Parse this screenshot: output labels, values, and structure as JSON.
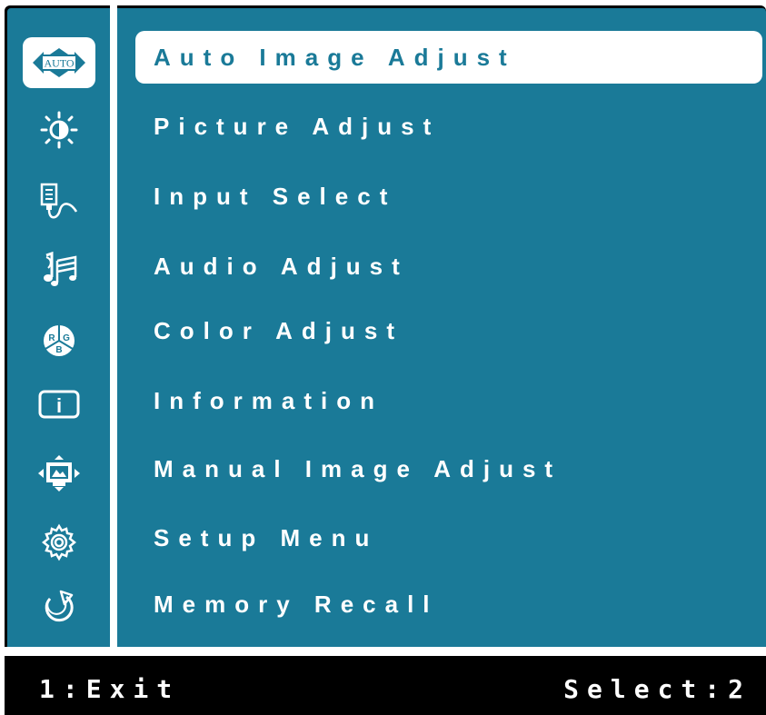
{
  "colors": {
    "panel": "#1a7a98",
    "highlight": "#ffffff",
    "footer": "#000000"
  },
  "menu": {
    "selected_index": 0,
    "items": [
      {
        "label": "Auto Image Adjust",
        "icon": "auto-icon"
      },
      {
        "label": "Picture Adjust",
        "icon": "brightness-icon"
      },
      {
        "label": "Input Select",
        "icon": "input-connector-icon"
      },
      {
        "label": "Audio Adjust",
        "icon": "music-note-icon"
      },
      {
        "label": "Color Adjust",
        "icon": "rgb-color-icon"
      },
      {
        "label": "Information",
        "icon": "info-icon"
      },
      {
        "label": "Manual Image Adjust",
        "icon": "image-adjust-icon"
      },
      {
        "label": "Setup Menu",
        "icon": "gear-icon"
      },
      {
        "label": "Memory Recall",
        "icon": "recall-arrow-icon"
      }
    ],
    "auto_badge": "AUTO",
    "rgb_letters": [
      "R",
      "G",
      "B"
    ],
    "info_letter": "i"
  },
  "footer": {
    "exit_hint": "1:Exit",
    "select_hint": "Select:2"
  }
}
